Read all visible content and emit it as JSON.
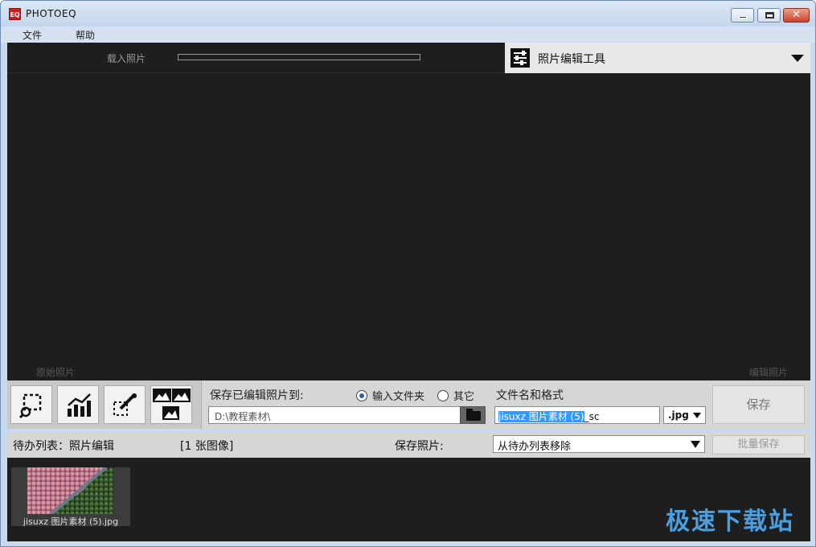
{
  "window": {
    "title": "PHOTOEQ",
    "app_icon_text": "EQ"
  },
  "menu": {
    "file": "文件",
    "help": "帮助"
  },
  "workspace": {
    "load_label": "载入照片",
    "load_progress": 0,
    "tool_dropdown_label": "照片编辑工具",
    "original_label": "原始照片",
    "edited_label": "编辑照片"
  },
  "save_panel": {
    "save_to_label": "保存已编辑照片到:",
    "radio_input_folder": "输入文件夹",
    "radio_other": "其它",
    "selected_radio": "input_folder",
    "path_value": "D:\\教程素材\\",
    "filename_label": "文件名和格式",
    "filename_selected": "jisuxz 图片素材 (5)",
    "filename_suffix": "_sc",
    "format_value": ".jpg",
    "save_button": "保存"
  },
  "queue": {
    "title": "待办列表：照片编辑",
    "count": "[1 张图像]",
    "save_photo_label": "保存照片:",
    "after_save_option": "从待办列表移除",
    "batch_save_button": "批量保存",
    "items": [
      {
        "name": "jisuxz 图片素材 (5).jpg"
      }
    ]
  },
  "watermark": "极速下载站",
  "icons": [
    "crop-select-icon",
    "chart-icon",
    "pen-edit-icon",
    "compare-view-icon"
  ]
}
